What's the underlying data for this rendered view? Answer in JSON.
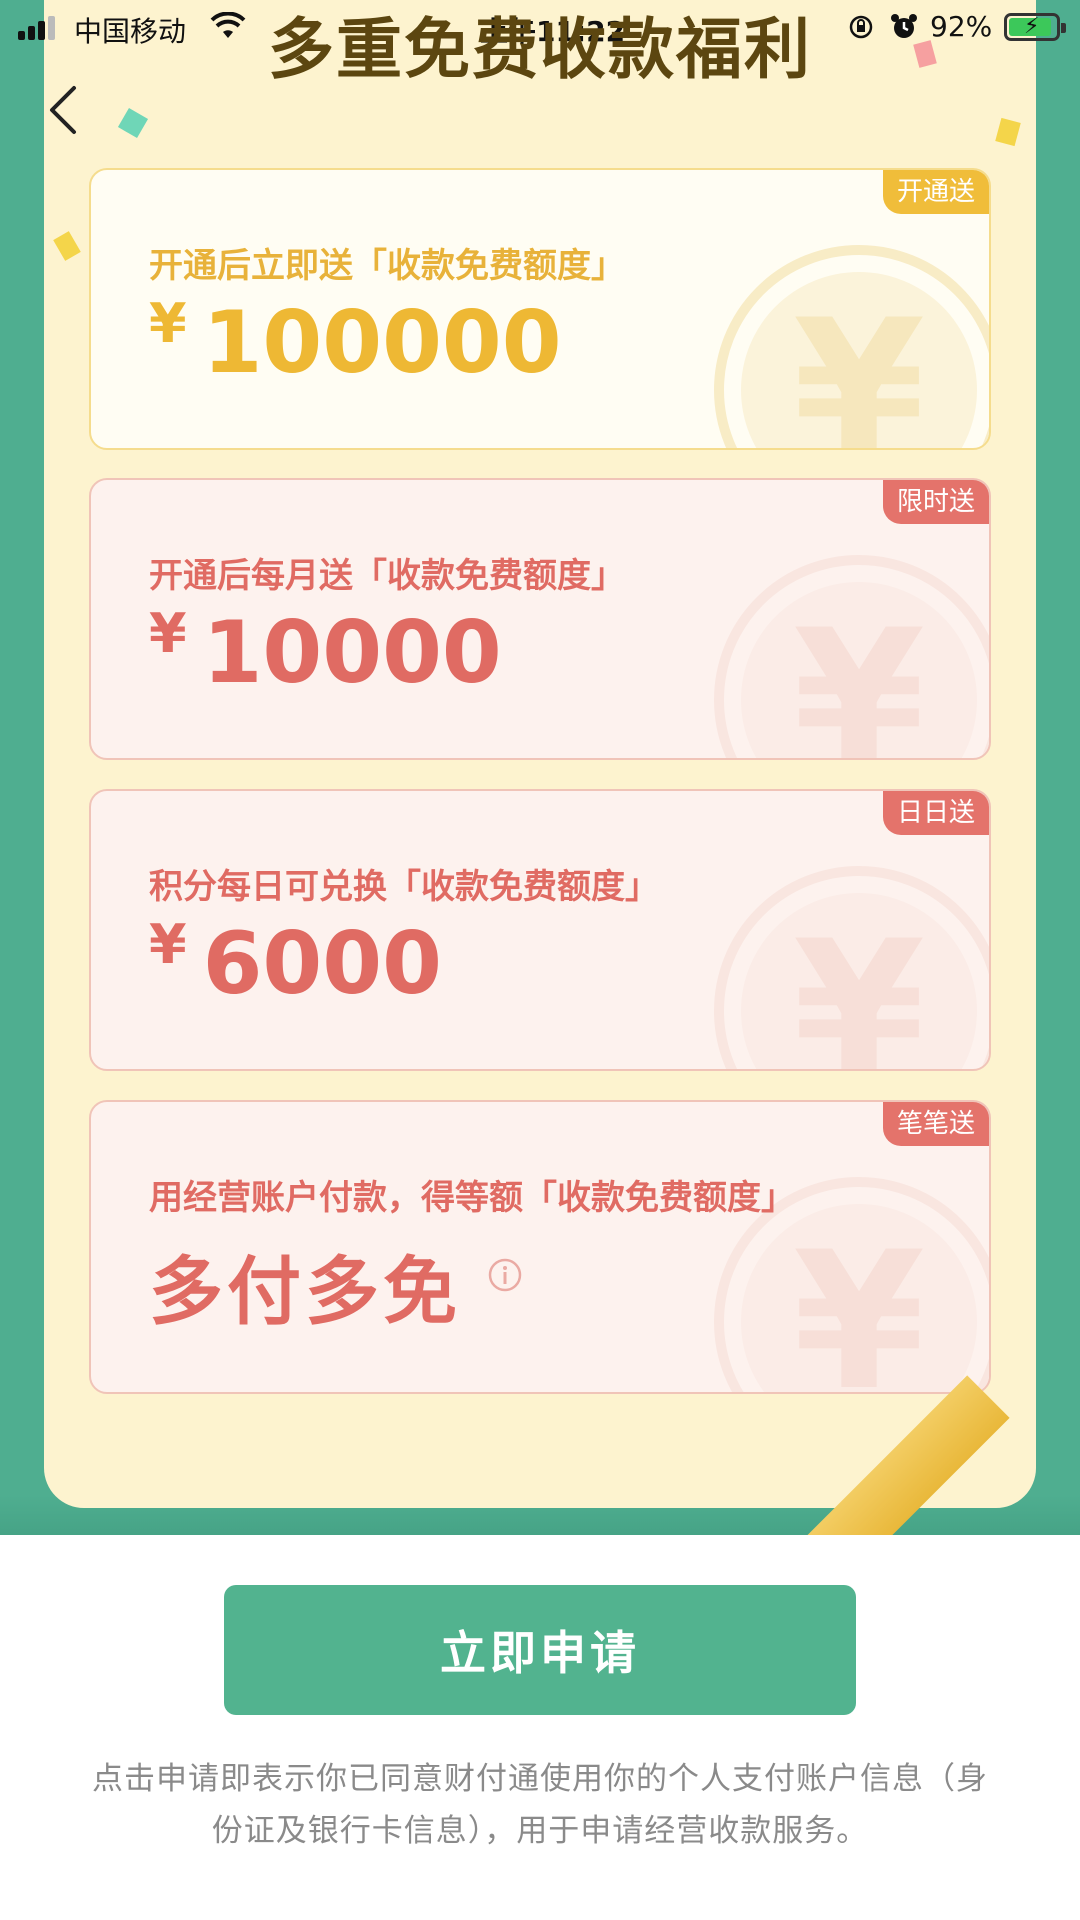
{
  "status_bar": {
    "carrier": "中国移动",
    "time": "上午11:22",
    "battery": "92%",
    "battery_level": 0.92
  },
  "header": {
    "title": "多重免费收款福利"
  },
  "cards": [
    {
      "tag": "开通送",
      "desc": "开通后立即送「收款免费额度」",
      "currency": "¥",
      "amount": "100000",
      "theme": "gold"
    },
    {
      "tag": "限时送",
      "desc": "开通后每月送「收款免费额度」",
      "currency": "¥",
      "amount": "10000",
      "theme": "red"
    },
    {
      "tag": "日日送",
      "desc": "积分每日可兑换「收款免费额度」",
      "currency": "¥",
      "amount": "6000",
      "theme": "red"
    },
    {
      "tag": "笔笔送",
      "desc": "用经营账户付款，得等额「收款免费额度」",
      "amount": "多付多免",
      "theme": "red"
    }
  ],
  "bottom": {
    "apply_label": "立即申请",
    "agreement_line1": "点击申请即表示你已同意财付通使用你的个人支付账户信息（身",
    "agreement_line2": "份证及银行卡信息），用于申请经营收款服务。"
  },
  "colors": {
    "green": "#4fae90",
    "cream": "#fdf3cf",
    "gold": "#eeb834",
    "red": "#e06b63",
    "button": "#52b38f"
  },
  "icons": [
    "back-arrow-icon",
    "info-icon",
    "wifi-icon",
    "alarm-icon",
    "battery-icon",
    "signal-icon",
    "yen-watermark-icon"
  ]
}
